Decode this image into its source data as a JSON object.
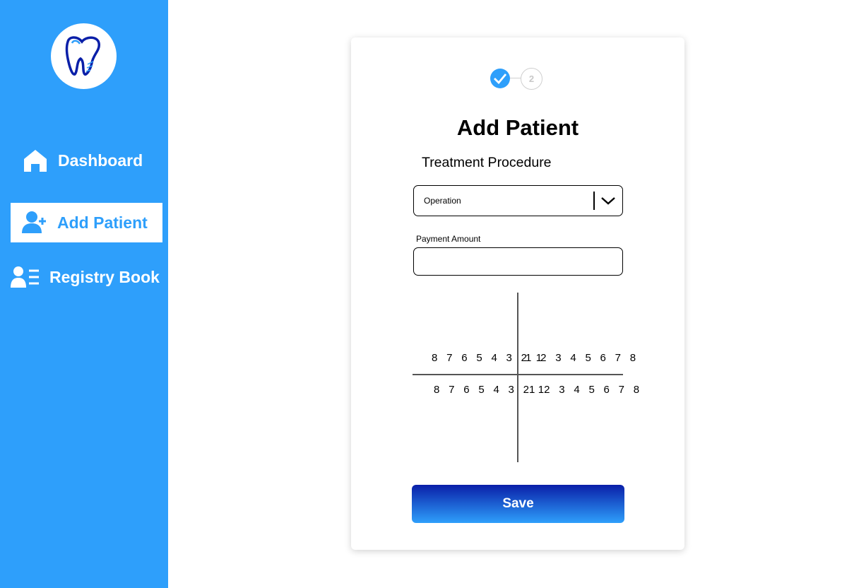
{
  "sidebar": {
    "logo_icon": "tooth-logo-icon",
    "items": [
      {
        "label": "Dashboard",
        "icon": "home-icon",
        "active": false
      },
      {
        "label": "Add Patient",
        "icon": "user-plus-icon",
        "active": true
      },
      {
        "label": "Registry Book",
        "icon": "user-list-icon",
        "active": false
      }
    ]
  },
  "stepper": {
    "current_step": 2,
    "step2_label": "2",
    "step1_icon": "check-icon"
  },
  "form": {
    "title": "Add Patient",
    "section_label": "Treatment Procedure",
    "procedure": {
      "value": "Operation",
      "icon": "chevron-down-icon"
    },
    "payment_label": "Payment Amount",
    "payment_value": "",
    "dental_chart": {
      "upper_left": "8 7 6 5 4 3 2 1",
      "upper_right": "1 2 3 4 5 6 7 8",
      "lower_left": "8 7 6 5 4 3 2 1",
      "lower_right": "1 2 3 4 5 6 7 8"
    },
    "save_label": "Save"
  },
  "colors": {
    "accent": "#2e9ffb",
    "button_top": "#0a1fa8",
    "button_bottom": "#2e9ffb"
  }
}
